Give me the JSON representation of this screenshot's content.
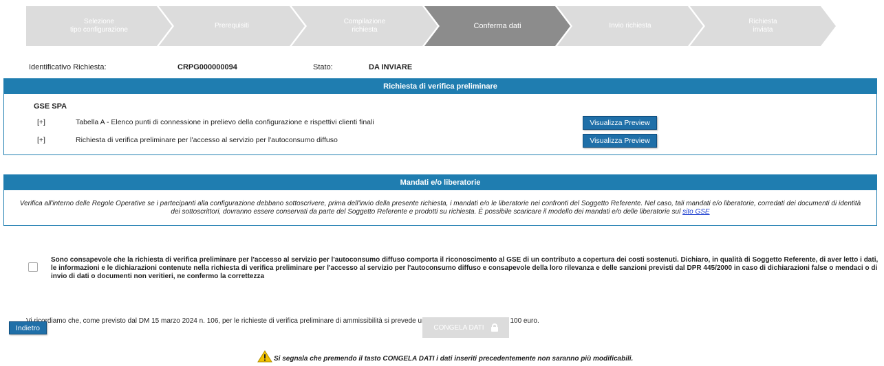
{
  "stepper": {
    "steps": [
      {
        "label": "Selezione\ntipo configurazione",
        "active": false
      },
      {
        "label": "Prerequisiti",
        "active": false
      },
      {
        "label": "Compilazione\nrichiesta",
        "active": false
      },
      {
        "label": "Conferma dati",
        "active": true
      },
      {
        "label": "Invio richiesta",
        "active": false
      },
      {
        "label": "Richiesta\ninviata",
        "active": false
      }
    ],
    "colors": {
      "inactive": "#dcdcdc",
      "active": "#8c8c8c"
    }
  },
  "info": {
    "id_label": "Identificativo Richiesta:",
    "id_value": "CRPG000000094",
    "status_label": "Stato:",
    "status_value": "DA INVIARE"
  },
  "verification_panel": {
    "title": "Richiesta di verifica preliminare",
    "company": "GSE SPA",
    "documents": [
      {
        "toggle": "[+]",
        "label": "Tabella A - Elenco punti di connessione in prelievo della configurazione e rispettivi clienti finali",
        "button": "Visualizza Preview"
      },
      {
        "toggle": "[+]",
        "label": "Richiesta di verifica preliminare per l'accesso al servizio per l'autoconsumo diffuso",
        "button": "Visualizza Preview"
      }
    ]
  },
  "mandates_panel": {
    "title": "Mandati e/o liberatorie",
    "text": "Verifica all'interno delle Regole Operative se i partecipanti alla configurazione debbano sottoscrivere, prima dell'invio della presente richiesta, i mandati e/o le liberatorie nei confronti del Soggetto Referente. Nel caso, tali mandati e/o liberatorie, corredati dei documenti di identità dei sottoscrittori, dovranno essere conservati da parte del Soggetto Referente e prodotti su richiesta. È possibile scaricare il modello dei mandati e/o delle liberatorie sul",
    "link_text": "sito GSE"
  },
  "declaration": {
    "checked": false,
    "text": "Sono consapevole che la richiesta di verifica preliminare per l'accesso al servizio per l'autoconsumo diffuso comporta il riconoscimento al GSE di un contributo a copertura dei costi sostenuti. Dichiaro, in qualità di Soggetto Referente, di aver letto i dati, le informazioni e le dichiarazioni contenute nella richiesta di verifica preliminare per l'accesso al servizio per l'autoconsumo diffuso e consapevole della loro rilevanza e delle sanzioni previsti dal DPR 445/2000 in caso di dichiarazioni false o mendaci o di invio di dati o documenti non veritieri, ne confermo la correttezza"
  },
  "fee_notice": "Vi ricordiamo che, come previsto dal DM 15 marzo 2024 n. 106, per le richieste di verifica preliminare di ammissibilità si prevede un corrispettivo una tantum di 100 euro.",
  "buttons": {
    "back": "Indietro",
    "freeze": "CONGELA DATI",
    "freeze_icon": "lock-icon",
    "freeze_enabled": false
  },
  "warning": {
    "icon": "warning-icon",
    "text": "Si segnala che premendo il tasto CONGELA DATI i dati inseriti precedentemente non saranno più modificabili."
  },
  "colors": {
    "accent": "#1f7db0",
    "button": "#1f6fa8",
    "link": "#1a3ccf",
    "warning": "#f2c200"
  }
}
